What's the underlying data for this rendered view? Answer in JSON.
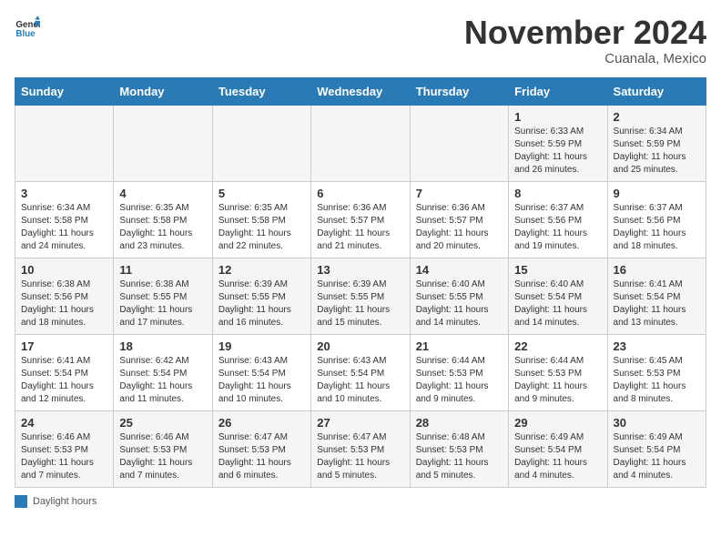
{
  "header": {
    "logo_general": "General",
    "logo_blue": "Blue",
    "month": "November 2024",
    "location": "Cuanala, Mexico"
  },
  "days_of_week": [
    "Sunday",
    "Monday",
    "Tuesday",
    "Wednesday",
    "Thursday",
    "Friday",
    "Saturday"
  ],
  "legend": {
    "label": "Daylight hours"
  },
  "weeks": [
    [
      {
        "day": "",
        "detail": ""
      },
      {
        "day": "",
        "detail": ""
      },
      {
        "day": "",
        "detail": ""
      },
      {
        "day": "",
        "detail": ""
      },
      {
        "day": "",
        "detail": ""
      },
      {
        "day": "1",
        "detail": "Sunrise: 6:33 AM\nSunset: 5:59 PM\nDaylight: 11 hours and 26 minutes."
      },
      {
        "day": "2",
        "detail": "Sunrise: 6:34 AM\nSunset: 5:59 PM\nDaylight: 11 hours and 25 minutes."
      }
    ],
    [
      {
        "day": "3",
        "detail": "Sunrise: 6:34 AM\nSunset: 5:58 PM\nDaylight: 11 hours and 24 minutes."
      },
      {
        "day": "4",
        "detail": "Sunrise: 6:35 AM\nSunset: 5:58 PM\nDaylight: 11 hours and 23 minutes."
      },
      {
        "day": "5",
        "detail": "Sunrise: 6:35 AM\nSunset: 5:58 PM\nDaylight: 11 hours and 22 minutes."
      },
      {
        "day": "6",
        "detail": "Sunrise: 6:36 AM\nSunset: 5:57 PM\nDaylight: 11 hours and 21 minutes."
      },
      {
        "day": "7",
        "detail": "Sunrise: 6:36 AM\nSunset: 5:57 PM\nDaylight: 11 hours and 20 minutes."
      },
      {
        "day": "8",
        "detail": "Sunrise: 6:37 AM\nSunset: 5:56 PM\nDaylight: 11 hours and 19 minutes."
      },
      {
        "day": "9",
        "detail": "Sunrise: 6:37 AM\nSunset: 5:56 PM\nDaylight: 11 hours and 18 minutes."
      }
    ],
    [
      {
        "day": "10",
        "detail": "Sunrise: 6:38 AM\nSunset: 5:56 PM\nDaylight: 11 hours and 18 minutes."
      },
      {
        "day": "11",
        "detail": "Sunrise: 6:38 AM\nSunset: 5:55 PM\nDaylight: 11 hours and 17 minutes."
      },
      {
        "day": "12",
        "detail": "Sunrise: 6:39 AM\nSunset: 5:55 PM\nDaylight: 11 hours and 16 minutes."
      },
      {
        "day": "13",
        "detail": "Sunrise: 6:39 AM\nSunset: 5:55 PM\nDaylight: 11 hours and 15 minutes."
      },
      {
        "day": "14",
        "detail": "Sunrise: 6:40 AM\nSunset: 5:55 PM\nDaylight: 11 hours and 14 minutes."
      },
      {
        "day": "15",
        "detail": "Sunrise: 6:40 AM\nSunset: 5:54 PM\nDaylight: 11 hours and 14 minutes."
      },
      {
        "day": "16",
        "detail": "Sunrise: 6:41 AM\nSunset: 5:54 PM\nDaylight: 11 hours and 13 minutes."
      }
    ],
    [
      {
        "day": "17",
        "detail": "Sunrise: 6:41 AM\nSunset: 5:54 PM\nDaylight: 11 hours and 12 minutes."
      },
      {
        "day": "18",
        "detail": "Sunrise: 6:42 AM\nSunset: 5:54 PM\nDaylight: 11 hours and 11 minutes."
      },
      {
        "day": "19",
        "detail": "Sunrise: 6:43 AM\nSunset: 5:54 PM\nDaylight: 11 hours and 10 minutes."
      },
      {
        "day": "20",
        "detail": "Sunrise: 6:43 AM\nSunset: 5:54 PM\nDaylight: 11 hours and 10 minutes."
      },
      {
        "day": "21",
        "detail": "Sunrise: 6:44 AM\nSunset: 5:53 PM\nDaylight: 11 hours and 9 minutes."
      },
      {
        "day": "22",
        "detail": "Sunrise: 6:44 AM\nSunset: 5:53 PM\nDaylight: 11 hours and 9 minutes."
      },
      {
        "day": "23",
        "detail": "Sunrise: 6:45 AM\nSunset: 5:53 PM\nDaylight: 11 hours and 8 minutes."
      }
    ],
    [
      {
        "day": "24",
        "detail": "Sunrise: 6:46 AM\nSunset: 5:53 PM\nDaylight: 11 hours and 7 minutes."
      },
      {
        "day": "25",
        "detail": "Sunrise: 6:46 AM\nSunset: 5:53 PM\nDaylight: 11 hours and 7 minutes."
      },
      {
        "day": "26",
        "detail": "Sunrise: 6:47 AM\nSunset: 5:53 PM\nDaylight: 11 hours and 6 minutes."
      },
      {
        "day": "27",
        "detail": "Sunrise: 6:47 AM\nSunset: 5:53 PM\nDaylight: 11 hours and 5 minutes."
      },
      {
        "day": "28",
        "detail": "Sunrise: 6:48 AM\nSunset: 5:53 PM\nDaylight: 11 hours and 5 minutes."
      },
      {
        "day": "29",
        "detail": "Sunrise: 6:49 AM\nSunset: 5:54 PM\nDaylight: 11 hours and 4 minutes."
      },
      {
        "day": "30",
        "detail": "Sunrise: 6:49 AM\nSunset: 5:54 PM\nDaylight: 11 hours and 4 minutes."
      }
    ]
  ]
}
